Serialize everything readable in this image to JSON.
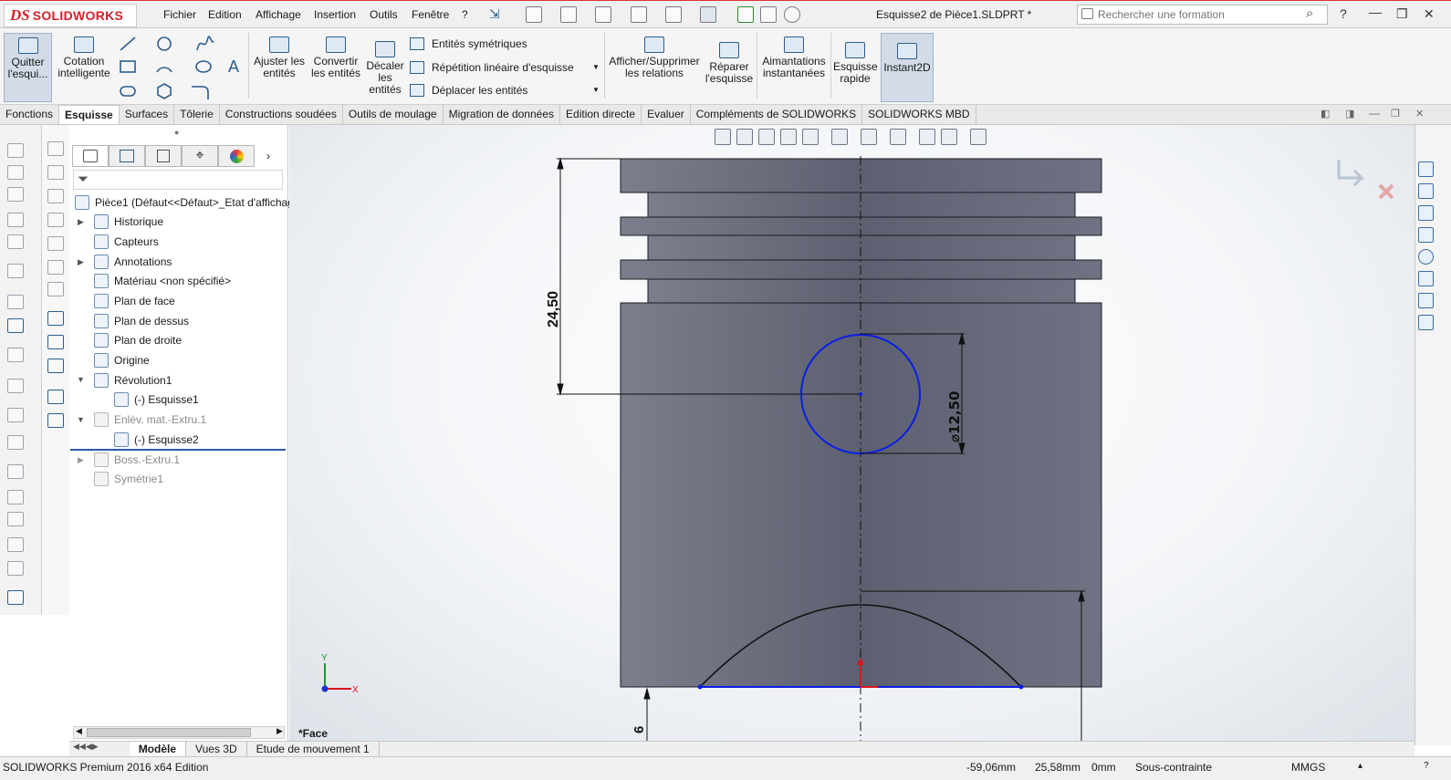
{
  "app": {
    "brand_ds": "DS",
    "brand_name": "SOLIDWORKS"
  },
  "menu": [
    "Fichier",
    "Edition",
    "Affichage",
    "Insertion",
    "Outils",
    "Fenêtre",
    "?"
  ],
  "window_title": "Esquisse2 de Pièce1.SLDPRT *",
  "search": {
    "placeholder": "Rechercher une formation"
  },
  "help_label": "?",
  "commands": {
    "exit_sketch": "Quitter l'esqui...",
    "smart_dimension": "Cotation intelligente",
    "trim": "Ajuster les entités",
    "convert": "Convertir les entités",
    "offset": "Décaler les entités",
    "mirror": "Entités symétriques",
    "linear_pattern": "Répétition linéaire d'esquisse",
    "move": "Déplacer les entités",
    "relations": "Afficher/Supprimer les relations",
    "repair": "Réparer l'esquisse",
    "snaps": "Aimantations instantanées",
    "rapid_sketch": "Esquisse rapide",
    "instant2d": "Instant2D"
  },
  "tabs": [
    "Fonctions",
    "Esquisse",
    "Surfaces",
    "Tôlerie",
    "Constructions soudées",
    "Outils de moulage",
    "Migration de données",
    "Edition directe",
    "Evaluer",
    "Compléments de SOLIDWORKS",
    "SOLIDWORKS MBD"
  ],
  "active_tab": "Esquisse",
  "tree": {
    "root": "Pièce1  (Défaut<<Défaut>_Etat d'affichage",
    "items": [
      {
        "label": "Historique",
        "dim": false
      },
      {
        "label": "Capteurs",
        "dim": false
      },
      {
        "label": "Annotations",
        "dim": false
      },
      {
        "label": "Matériau <non spécifié>",
        "dim": false
      },
      {
        "label": "Plan de face",
        "dim": false
      },
      {
        "label": "Plan de dessus",
        "dim": false
      },
      {
        "label": "Plan de droite",
        "dim": false
      },
      {
        "label": "Origine",
        "dim": false
      },
      {
        "label": "Révolution1",
        "dim": false
      },
      {
        "label": "(-) Esquisse1",
        "dim": false
      },
      {
        "label": "Enlèv. mat.-Extru.1",
        "dim": true
      },
      {
        "label": "(-) Esquisse2",
        "dim": false
      },
      {
        "label": "Boss.-Extru.1",
        "dim": true
      },
      {
        "label": "Symétrie1",
        "dim": true
      }
    ]
  },
  "viewport": {
    "orientation_label": "*Face",
    "dim_height": "24,50",
    "dim_diameter": "⌀12,50",
    "dim_bottom": "6",
    "axis_x": "X",
    "axis_y": "Y",
    "sketch_color": "#0a1ee6",
    "part_color": "#6e7180"
  },
  "bottom_tabs": [
    "Modèle",
    "Vues 3D",
    "Etude de mouvement 1"
  ],
  "active_bottom_tab": "Modèle",
  "status": {
    "edition": "SOLIDWORKS Premium 2016 x64 Edition",
    "x": "-59,06mm",
    "y": "25,58mm",
    "z": "0mm",
    "state": "Sous-contrainte",
    "units": "MMGS"
  }
}
